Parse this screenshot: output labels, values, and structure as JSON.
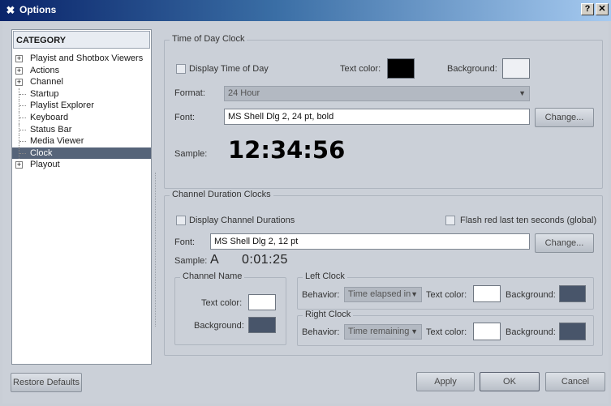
{
  "window": {
    "title": "Options",
    "help_label": "?",
    "close_label": "✕"
  },
  "category": {
    "header": "CATEGORY",
    "items": [
      {
        "label": "Playist and Shotbox Viewers",
        "expandable": true
      },
      {
        "label": "Actions",
        "expandable": true
      },
      {
        "label": "Channel",
        "expandable": true
      },
      {
        "label": "Startup",
        "expandable": false
      },
      {
        "label": "Playlist Explorer",
        "expandable": false
      },
      {
        "label": "Keyboard",
        "expandable": false
      },
      {
        "label": "Status Bar",
        "expandable": false
      },
      {
        "label": "Media Viewer",
        "expandable": false
      },
      {
        "label": "Clock",
        "expandable": false,
        "selected": true
      },
      {
        "label": "Playout",
        "expandable": true
      }
    ]
  },
  "time_of_day": {
    "group_title": "Time of Day Clock",
    "display_label": "Display Time of Day",
    "display_checked": false,
    "text_color_label": "Text color:",
    "text_color": "#000000",
    "background_label": "Background:",
    "background_color": "#eef0f4",
    "format_label": "Format:",
    "format_value": "24 Hour",
    "font_label": "Font:",
    "font_value": "MS Shell Dlg 2, 24 pt, bold",
    "change_label": "Change...",
    "sample_label": "Sample:",
    "sample_value": "12:34:56"
  },
  "channel_duration": {
    "group_title": "Channel Duration Clocks",
    "display_label": "Display Channel Durations",
    "display_checked": false,
    "flash_label": "Flash red last ten seconds (global)",
    "flash_checked": false,
    "font_label": "Font:",
    "font_value": "MS Shell Dlg 2, 12 pt",
    "change_label": "Change...",
    "sample_label": "Sample:",
    "sample_channel": "A",
    "sample_time": "0:01:25",
    "channel_name": {
      "group_title": "Channel Name",
      "text_color_label": "Text color:",
      "text_color": "#ffffff",
      "background_label": "Background:",
      "background_color": "#48556a"
    },
    "left_clock": {
      "group_title": "Left  Clock",
      "behavior_label": "Behavior:",
      "behavior_value": "Time elapsed in",
      "text_color_label": "Text color:",
      "text_color": "#ffffff",
      "background_label": "Background:",
      "background_color": "#48556a"
    },
    "right_clock": {
      "group_title": "Right Clock",
      "behavior_label": "Behavior:",
      "behavior_value": "Time remaining",
      "text_color_label": "Text color:",
      "text_color": "#ffffff",
      "background_label": "Background:",
      "background_color": "#48556a"
    }
  },
  "buttons": {
    "restore_defaults": "Restore Defaults",
    "apply": "Apply",
    "ok": "OK",
    "cancel": "Cancel"
  }
}
